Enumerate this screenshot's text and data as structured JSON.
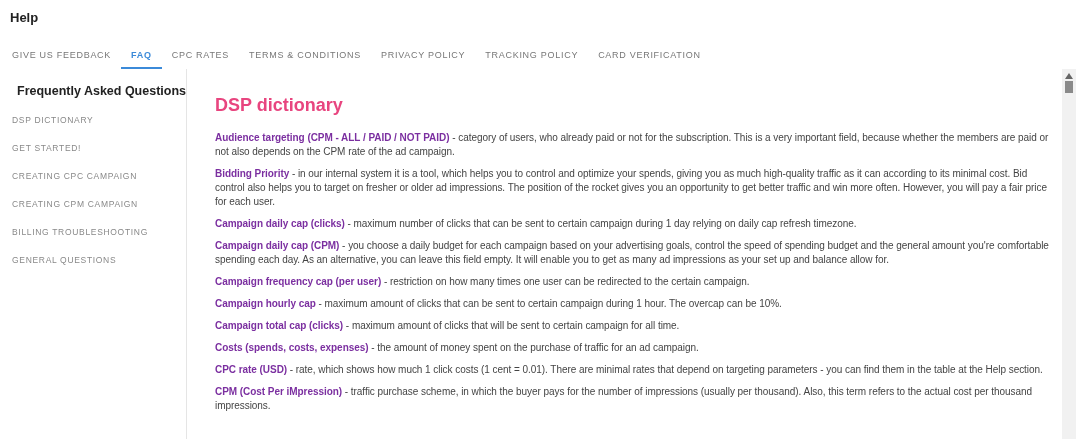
{
  "window": {
    "title": "Help"
  },
  "tabs": [
    {
      "label": "GIVE US FEEDBACK",
      "selected": false
    },
    {
      "label": "FAQ",
      "selected": true
    },
    {
      "label": "CPC RATES",
      "selected": false
    },
    {
      "label": "TERMS & CONDITIONS",
      "selected": false
    },
    {
      "label": "PRIVACY POLICY",
      "selected": false
    },
    {
      "label": "TRACKING POLICY",
      "selected": false
    },
    {
      "label": "CARD VERIFICATION",
      "selected": false
    }
  ],
  "sidebar": {
    "title": "Frequently Asked Questions",
    "items": [
      "DSP DICTIONARY",
      "GET STARTED!",
      "CREATING CPC CAMPAIGN",
      "CREATING CPM CAMPAIGN",
      "BILLING TROUBLESHOOTING",
      "GENERAL QUESTIONS"
    ]
  },
  "content": {
    "heading": "DSP dictionary",
    "entries": [
      "**Audience targeting (CPM - ALL / PAID / NOT PAID)** -  category of users, who already paid or not for the subscription. This is a very important field, because whether the members are paid or not also depends on the CPM rate of the ad campaign.",
      "**Bidding Priority** - in our internal system it is a tool, which helps you to control and optimize your spends, giving you as much high-quality traffic as it can according to its minimal cost. Bid control also helps you to target on fresher or older ad impressions. The position of the rocket gives you an opportunity to get better traffic and win more often. However, you will pay a fair price for each user.",
      "**Campaign daily cap (clicks)** - maximum number of clicks that can be sent to certain campaign during 1 day relying on daily cap refresh timezone.",
      "**Campaign daily cap (CPM)** - you choose a daily budget for each campaign based on your advertising goals, control the speed of spending budget and the general amount you're comfortable spending each day. As an alternative, you can leave this field empty. It will enable you to get as many ad impressions as your set up and balance allow for.",
      "**Campaign frequency cap (per user)** - restriction on how many times one user can be redirected to the certain campaign.",
      "**Campaign hourly cap** - maximum amount of clicks that can be sent to certain campaign during 1 hour. The overcap can be 10%.",
      "**Campaign total cap (clicks)** - maximum amount of clicks that will be sent to certain campaign for all time.",
      "**Costs (spends, costs, expenses)** - the amount of money spent on the purchase of traffic for an ad campaign.",
      "**CPC rate (USD)** - rate, which shows how much 1 click costs (1 cent = 0.01). There are minimal rates that depend on targeting parameters - you can find them in the table at the Help section.",
      "**CPM (Cost Per iMpression)** - traffic purchase scheme, in which the buyer pays for the number of impressions (usually per thousand). Also, this term refers to the actual cost per thousand impressions."
    ]
  }
}
